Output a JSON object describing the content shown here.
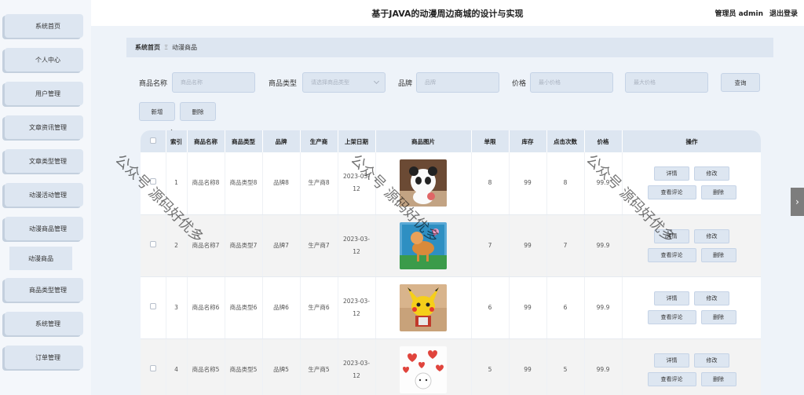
{
  "header": {
    "title": "基于JAVA的动漫周边商城的设计与实现",
    "user_role": "管理员",
    "username": "admin",
    "logout": "退出登录"
  },
  "sidebar": {
    "items": [
      {
        "label": "系统首页"
      },
      {
        "label": "个人中心"
      },
      {
        "label": "用户管理"
      },
      {
        "label": "文章资讯管理"
      },
      {
        "label": "文章类型管理"
      },
      {
        "label": "动漫活动管理"
      },
      {
        "label": "动漫商品管理"
      },
      {
        "label": "商品类型管理"
      },
      {
        "label": "系统管理"
      },
      {
        "label": "订单管理"
      }
    ],
    "active_sub": "动漫商品"
  },
  "breadcrumb": {
    "home": "系统首页",
    "separator": "Ξ",
    "current": "动漫商品"
  },
  "filters": {
    "name_label": "商品名称",
    "name_placeholder": "商品名称",
    "type_label": "商品类型",
    "type_placeholder": "请选择商品类型",
    "brand_label": "品牌",
    "brand_placeholder": "品牌",
    "price_label": "价格",
    "price_min_placeholder": "最小价格",
    "price_max_placeholder": "最大价格",
    "search_button": "查询"
  },
  "actions": {
    "add": "新增",
    "delete": "删除"
  },
  "table": {
    "headers": [
      "",
      "索引",
      "商品名称",
      "商品类型",
      "品牌",
      "生产商",
      "上架日期",
      "商品图片",
      "单限",
      "库存",
      "点击次数",
      "价格",
      "操作"
    ],
    "rows": [
      {
        "index": "1",
        "name": "商品名称8",
        "type": "商品类型8",
        "brand": "品牌8",
        "maker": "生产商8",
        "date": "2023-03-12",
        "image": "panda",
        "limit": "8",
        "stock": "99",
        "clicks": "8",
        "price": "99.9"
      },
      {
        "index": "2",
        "name": "商品名称7",
        "type": "商品类型7",
        "brand": "品牌7",
        "maker": "生产商7",
        "date": "2023-03-12",
        "image": "deer",
        "limit": "7",
        "stock": "99",
        "clicks": "7",
        "price": "99.9"
      },
      {
        "index": "3",
        "name": "商品名称6",
        "type": "商品类型6",
        "brand": "品牌6",
        "maker": "生产商6",
        "date": "2023-03-12",
        "image": "pikachu",
        "limit": "6",
        "stock": "99",
        "clicks": "6",
        "price": "99.9"
      },
      {
        "index": "4",
        "name": "商品名称5",
        "type": "商品类型5",
        "brand": "品牌5",
        "maker": "生产商5",
        "date": "2023-03-12",
        "image": "hearts",
        "limit": "5",
        "stock": "99",
        "clicks": "5",
        "price": "99.9"
      }
    ],
    "row_actions": {
      "detail": "详情",
      "edit": "修改",
      "comments": "查看评论",
      "delete": "删除"
    }
  },
  "watermark": "公众号 源码好优多",
  "side_tab": "›"
}
